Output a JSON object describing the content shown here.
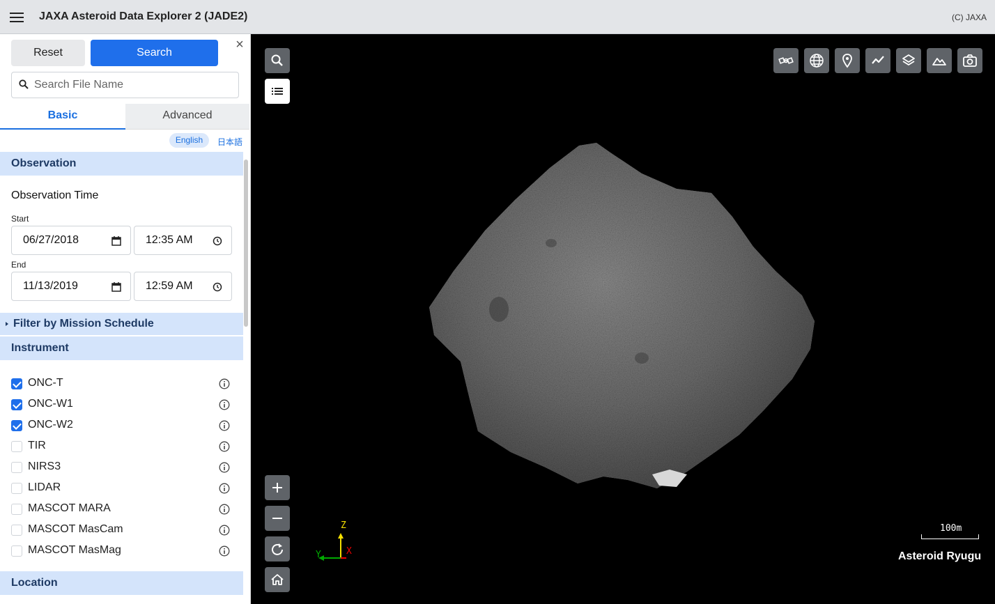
{
  "header": {
    "title": "JAXA Asteroid Data Explorer 2 (JADE2)",
    "copyright": "(C) JAXA"
  },
  "sidebar": {
    "reset_label": "Reset",
    "search_label": "Search",
    "search_placeholder": "Search File Name",
    "tabs": [
      "Basic",
      "Advanced"
    ],
    "languages": [
      "English",
      "日本語"
    ],
    "observation": {
      "section_title": "Observation",
      "time_title": "Observation Time",
      "start_label": "Start",
      "start_date": "06/27/2018",
      "start_time": "12:35 AM",
      "end_label": "End",
      "end_date": "11/13/2019",
      "end_time": "12:59 AM"
    },
    "filter_label": "Filter by Mission Schedule",
    "instrument": {
      "section_title": "Instrument",
      "items": [
        {
          "label": "ONC-T",
          "checked": true
        },
        {
          "label": "ONC-W1",
          "checked": true
        },
        {
          "label": "ONC-W2",
          "checked": true
        },
        {
          "label": "TIR",
          "checked": false
        },
        {
          "label": "NIRS3",
          "checked": false
        },
        {
          "label": "LIDAR",
          "checked": false
        },
        {
          "label": "MASCOT MARA",
          "checked": false
        },
        {
          "label": "MASCOT MasCam",
          "checked": false
        },
        {
          "label": "MASCOT MasMag",
          "checked": false
        }
      ]
    },
    "location_title": "Location"
  },
  "viewer": {
    "scale_label": "100m",
    "target_name": "Asteroid Ryugu",
    "axes": {
      "z": "Z",
      "y": "Y",
      "x": "X"
    },
    "colors": {
      "accent": "#1f6feb",
      "section_bg": "#d4e4fb",
      "tool_button": "#5f6368"
    },
    "toolbar_icons": [
      "spacecraft-icon",
      "globe-icon",
      "location-pin-icon",
      "line-chart-icon",
      "layers-icon",
      "terrain-icon",
      "camera-icon"
    ]
  }
}
